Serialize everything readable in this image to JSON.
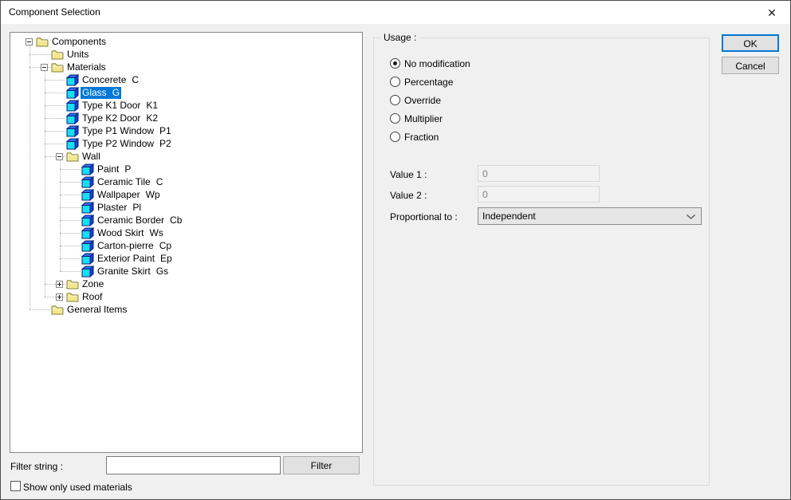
{
  "window": {
    "title": "Component Selection",
    "close_icon": "✕"
  },
  "tree": {
    "items": [
      {
        "name": "Components",
        "type": "folder",
        "level": 0,
        "expander": "minus"
      },
      {
        "name": "Units",
        "type": "folder",
        "level": 1
      },
      {
        "name": "Materials",
        "type": "folder",
        "level": 1,
        "expander": "minus"
      },
      {
        "name": "Concerete",
        "code": "C",
        "type": "cube",
        "level": 2
      },
      {
        "name": "Glass",
        "code": "G",
        "type": "cube",
        "level": 2,
        "selected": true
      },
      {
        "name": "Type K1 Door",
        "code": "K1",
        "type": "cube",
        "level": 2
      },
      {
        "name": "Type K2 Door",
        "code": "K2",
        "type": "cube",
        "level": 2
      },
      {
        "name": "Type P1 Window",
        "code": "P1",
        "type": "cube",
        "level": 2
      },
      {
        "name": "Type P2 Window",
        "code": "P2",
        "type": "cube",
        "level": 2
      },
      {
        "name": "Wall",
        "type": "folder",
        "level": 2,
        "expander": "minus"
      },
      {
        "name": "Paint",
        "code": "P",
        "type": "cube",
        "level": 3
      },
      {
        "name": "Ceramic Tile",
        "code": "C",
        "type": "cube",
        "level": 3
      },
      {
        "name": "Wallpaper",
        "code": "Wp",
        "type": "cube",
        "level": 3
      },
      {
        "name": "Plaster",
        "code": "Pl",
        "type": "cube",
        "level": 3
      },
      {
        "name": "Ceramic Border",
        "code": "Cb",
        "type": "cube",
        "level": 3
      },
      {
        "name": "Wood Skirt",
        "code": "Ws",
        "type": "cube",
        "level": 3
      },
      {
        "name": "Carton-pierre",
        "code": "Cp",
        "type": "cube",
        "level": 3
      },
      {
        "name": "Exterior Paint",
        "code": "Ep",
        "type": "cube",
        "level": 3
      },
      {
        "name": "Granite Skirt",
        "code": "Gs",
        "type": "cube",
        "level": 3
      },
      {
        "name": "Zone",
        "type": "folder",
        "level": 2,
        "expander": "plus"
      },
      {
        "name": "Roof",
        "type": "folder",
        "level": 2,
        "expander": "plus"
      },
      {
        "name": "General Items",
        "type": "folder",
        "level": 1
      }
    ]
  },
  "filter": {
    "label": "Filter string :",
    "value": "",
    "button_label": "Filter"
  },
  "show_only_used": {
    "label": "Show only used materials",
    "checked": false
  },
  "usage": {
    "group_label": "Usage :",
    "options": [
      {
        "label": "No modification",
        "selected": true
      },
      {
        "label": "Percentage",
        "selected": false
      },
      {
        "label": "Override",
        "selected": false
      },
      {
        "label": "Multiplier",
        "selected": false
      },
      {
        "label": "Fraction",
        "selected": false
      }
    ],
    "value1_label": "Value 1 :",
    "value1": "0",
    "value2_label": "Value 2 :",
    "value2": "0",
    "proportional_label": "Proportional to :",
    "proportional_value": "Independent"
  },
  "actions": {
    "ok_label": "OK",
    "cancel_label": "Cancel"
  },
  "colors": {
    "selection_bg": "#0078d7",
    "accent": "#0078d7",
    "folder_fill": "#f1e78f",
    "folder_stroke": "#85803c",
    "cube_front": "#16dff2",
    "cube_top": "#2e6cf0",
    "cube_side": "#1340d8",
    "cube_stroke": "#071f7a"
  }
}
